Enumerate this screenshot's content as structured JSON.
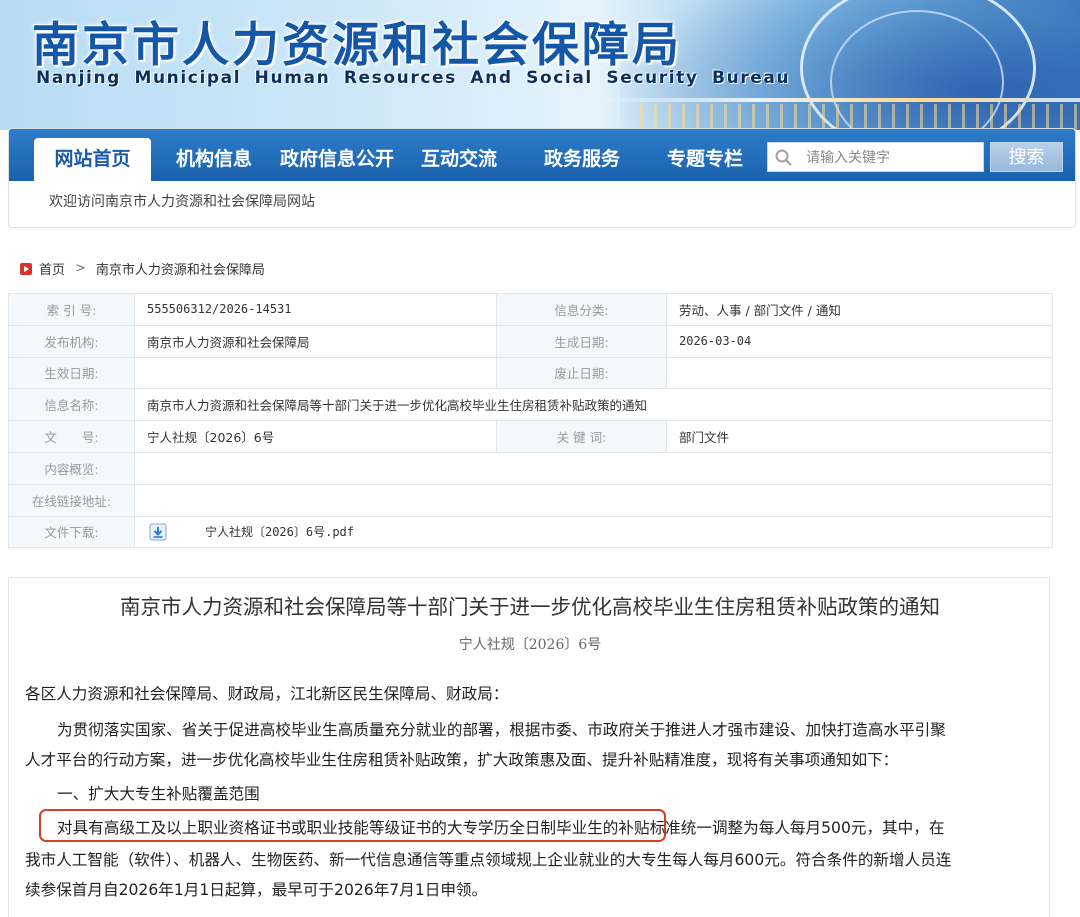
{
  "header": {
    "title": "南京市人力资源和社会保障局",
    "subtitle": "Nanjing Municipal Human Resources And Social Security Bureau"
  },
  "nav": {
    "items": [
      {
        "label": "网站首页",
        "active": true
      },
      {
        "label": "机构信息",
        "active": false
      },
      {
        "label": "政府信息公开",
        "active": false
      },
      {
        "label": "互动交流",
        "active": false
      },
      {
        "label": "政务服务",
        "active": false
      },
      {
        "label": "专题专栏",
        "active": false
      }
    ],
    "search_placeholder": "请输入关键字",
    "search_button": "搜索",
    "welcome": "欢迎访问南京市人力资源和社会保障局网站"
  },
  "breadcrumb": {
    "home": "首页",
    "sep": ">",
    "current": "南京市人力资源和社会保障局"
  },
  "info": {
    "index_label": "索 引 号:",
    "index_value": "555506312/2026-14531",
    "category_label": "信息分类:",
    "category_value": "劳动、人事 / 部门文件 / 通知",
    "publisher_label": "发布机构:",
    "publisher_value": "南京市人力资源和社会保障局",
    "created_label": "生成日期:",
    "created_value": "2026-03-04",
    "effective_label": "生效日期:",
    "effective_value": "",
    "repeal_label": "废止日期:",
    "repeal_value": "",
    "name_label": "信息名称:",
    "name_value": "南京市人力资源和社会保障局等十部门关于进一步优化高校毕业生住房租赁补贴政策的通知",
    "docno_label": "文　　号:",
    "docno_value": "宁人社规〔2026〕6号",
    "keywords_label": "关 键 词:",
    "keywords_value": "部门文件",
    "summary_label": "内容概览:",
    "summary_value": "",
    "link_label": "在线链接地址:",
    "link_value": "",
    "download_label": "文件下载:",
    "download_file": "宁人社规〔2026〕6号.pdf"
  },
  "article": {
    "title": "南京市人力资源和社会保障局等十部门关于进一步优化高校毕业生住房租赁补贴政策的通知",
    "doc_number": "宁人社规〔2026〕6号",
    "recipients": "各区人力资源和社会保障局、财政局，江北新区民生保障局、财政局：",
    "intro_line1": "为贯彻落实国家、省关于促进高校毕业生高质量充分就业的部署，根据市委、市政府关于推进人才强市建设、加快打造高水平引聚",
    "intro_line2": "人才平台的行动方案，进一步优化高校毕业生住房租赁补贴政策，扩大政策惠及面、提升补贴精准度，现将有关事项通知如下：",
    "section1_heading": "一、扩大大专生补贴覆盖范围",
    "s1_highlighted": "对具有高级工及以上职业资格证书或职业技能等级证书的大专学历全日制毕业生",
    "s1_rest": "的补贴标准统一调整为每人每月500元，其中，在",
    "s1_line2": "我市人工智能（软件）、机器人、生物医药、新一代信息通信等重点领域规上企业就业的大专生每人每月600元。符合条件的新增人员连",
    "s1_line3": "续参保首月自2026年1月1日起算，最早可于2026年7月1日申领。"
  }
}
